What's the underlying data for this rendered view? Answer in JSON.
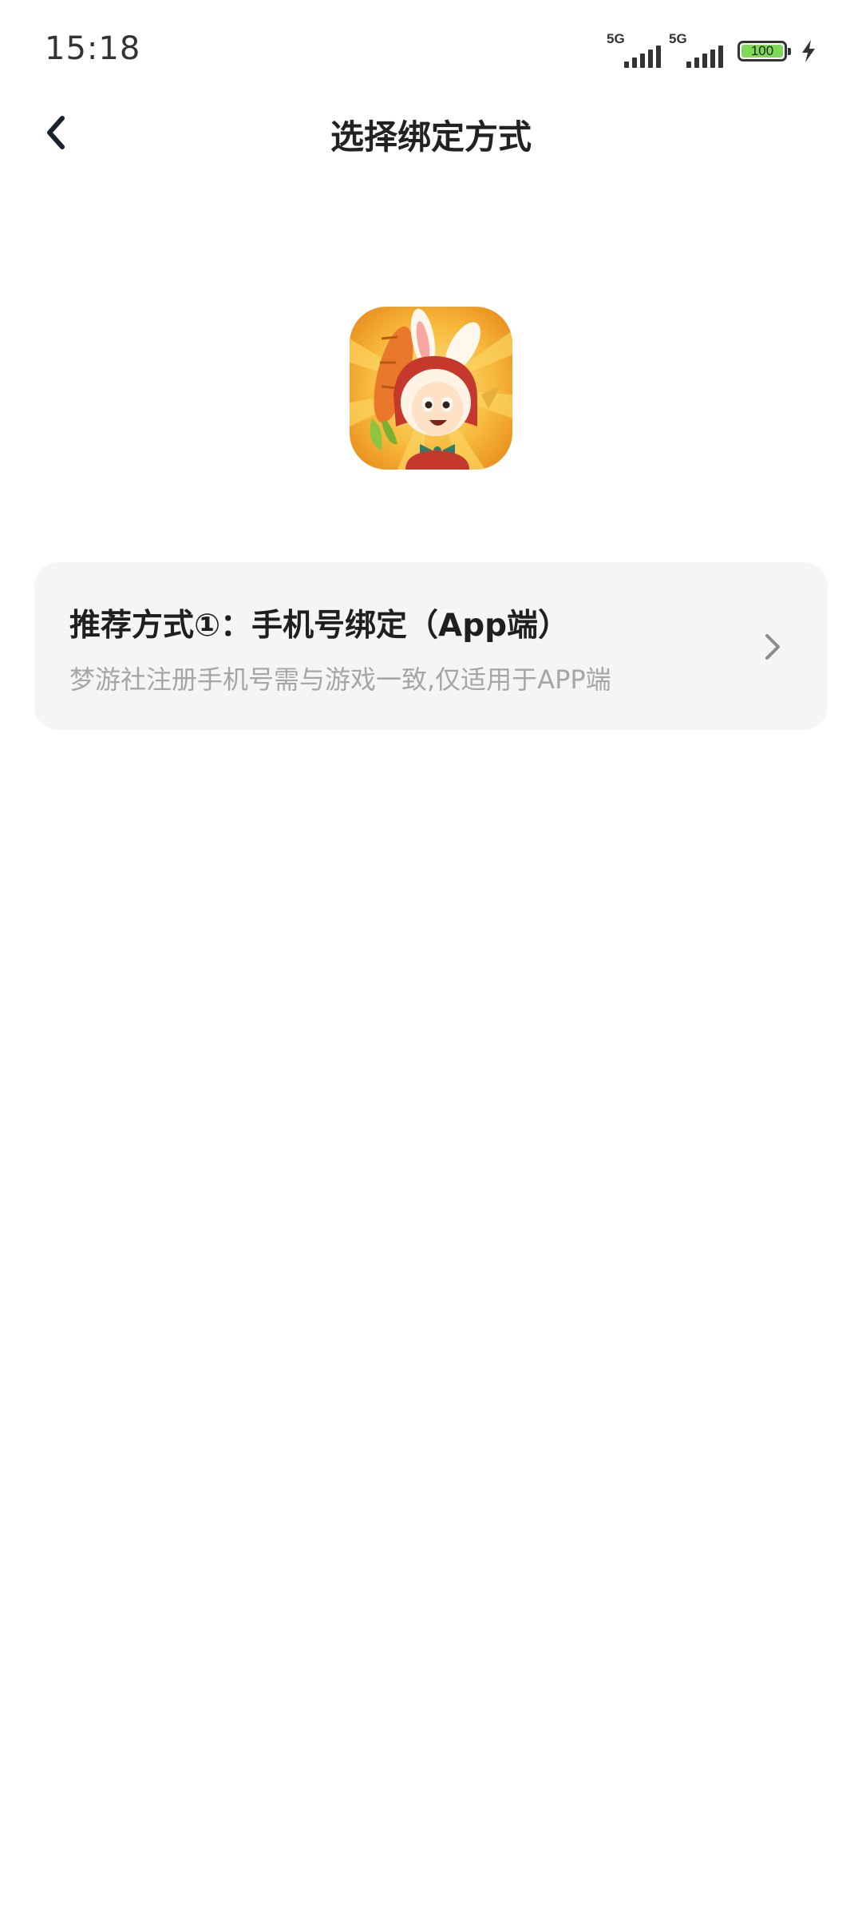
{
  "status_bar": {
    "time": "15:18",
    "signal_1_tech": "5G",
    "signal_2_tech": "5G",
    "battery_level": "100",
    "charging": true
  },
  "nav": {
    "back_icon": "chevron-left-icon",
    "title": "选择绑定方式"
  },
  "app_icon": {
    "name": "game-app-icon"
  },
  "options": [
    {
      "title": "推荐方式①：手机号绑定（App端）",
      "description": "梦游社注册手机号需与游戏一致,仅适用于APP端",
      "icon": "chevron-right-icon"
    }
  ],
  "colors": {
    "card_background": "#f4f5f5",
    "description_text": "#a6a6a6",
    "battery_fill": "#7ed957"
  }
}
